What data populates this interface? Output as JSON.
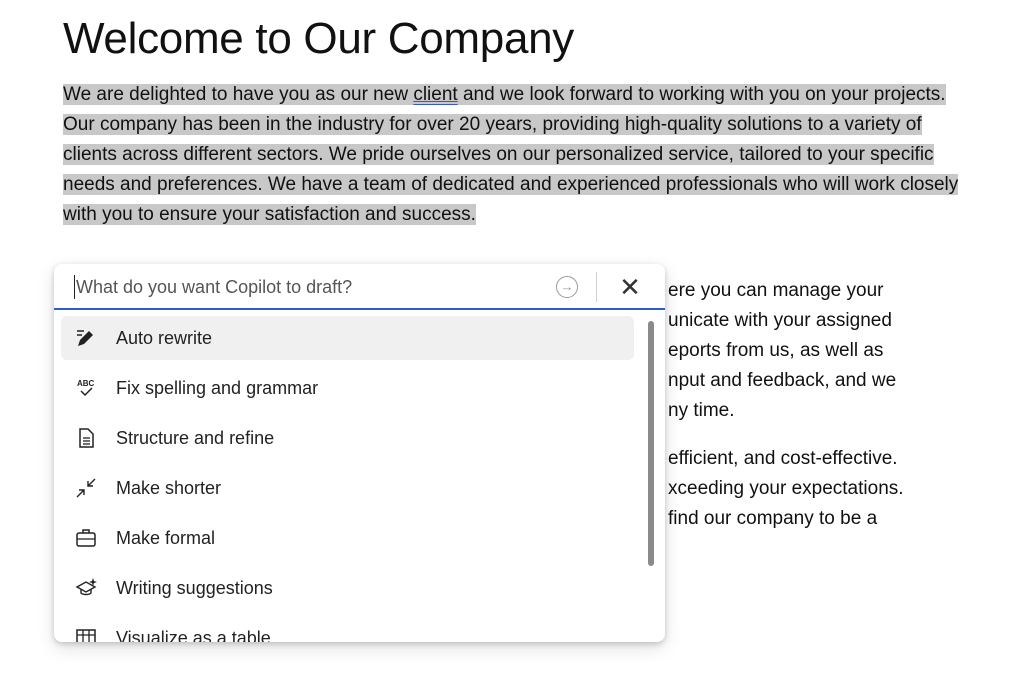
{
  "document": {
    "title": "Welcome to Our Company",
    "para1": {
      "before": "We are delighted to have you as our new ",
      "flagged": "client",
      "after": " and we look forward to working with you on your projects. Our company has been in the industry for over 20 years, providing high-quality solutions to a variety of clients across different sectors. We pride ourselves on our personalized service, tailored to your specific needs and preferences. We have a team of dedicated and experienced professionals who will work closely with you to ensure your satisfaction and success."
    },
    "visible_fragments": [
      "ere you can manage your",
      "unicate with your assigned",
      "eports from us, as well as",
      "nput and feedback, and we",
      "ny time.",
      "efficient, and cost-effective.",
      "xceeding your expectations.",
      "find our company to be a"
    ]
  },
  "copilot": {
    "placeholder": "What do you want Copilot to draft?",
    "send_icon": "arrow-circle-icon",
    "close_icon": "close-icon",
    "menu": [
      {
        "label": "Auto rewrite",
        "icon": "pen-sparkle-icon"
      },
      {
        "label": "Fix spelling and grammar",
        "icon": "spellcheck-icon"
      },
      {
        "label": "Structure and refine",
        "icon": "document-icon"
      },
      {
        "label": "Make shorter",
        "icon": "shrink-arrows-icon"
      },
      {
        "label": "Make formal",
        "icon": "briefcase-icon"
      },
      {
        "label": "Writing suggestions",
        "icon": "cap-sparkle-icon"
      },
      {
        "label": "Visualize as a table",
        "icon": "table-icon"
      }
    ]
  },
  "colors": {
    "selection": "#c8c8c8",
    "accent": "#2c5ec9"
  }
}
